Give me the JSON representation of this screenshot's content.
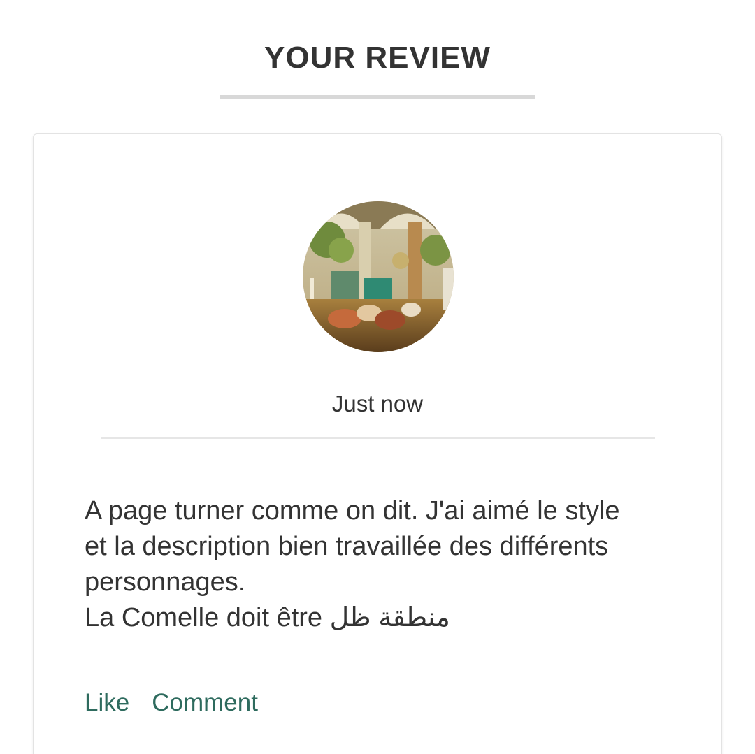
{
  "header": {
    "title": "YOUR REVIEW"
  },
  "review": {
    "avatar_icon": "painting-avatar-icon",
    "timestamp": "Just now",
    "text_lines": [
      "A page turner comme on dit. J'ai aimé le style et la description bien travaillée des différents personnages.",
      "La Comelle doit être منطقة ظل"
    ],
    "actions": {
      "like_label": "Like",
      "comment_label": "Comment"
    }
  },
  "colors": {
    "title": "#333333",
    "link": "#2e6b5e",
    "divider": "#e6e6e6",
    "title_underline": "#d8d8d8"
  }
}
